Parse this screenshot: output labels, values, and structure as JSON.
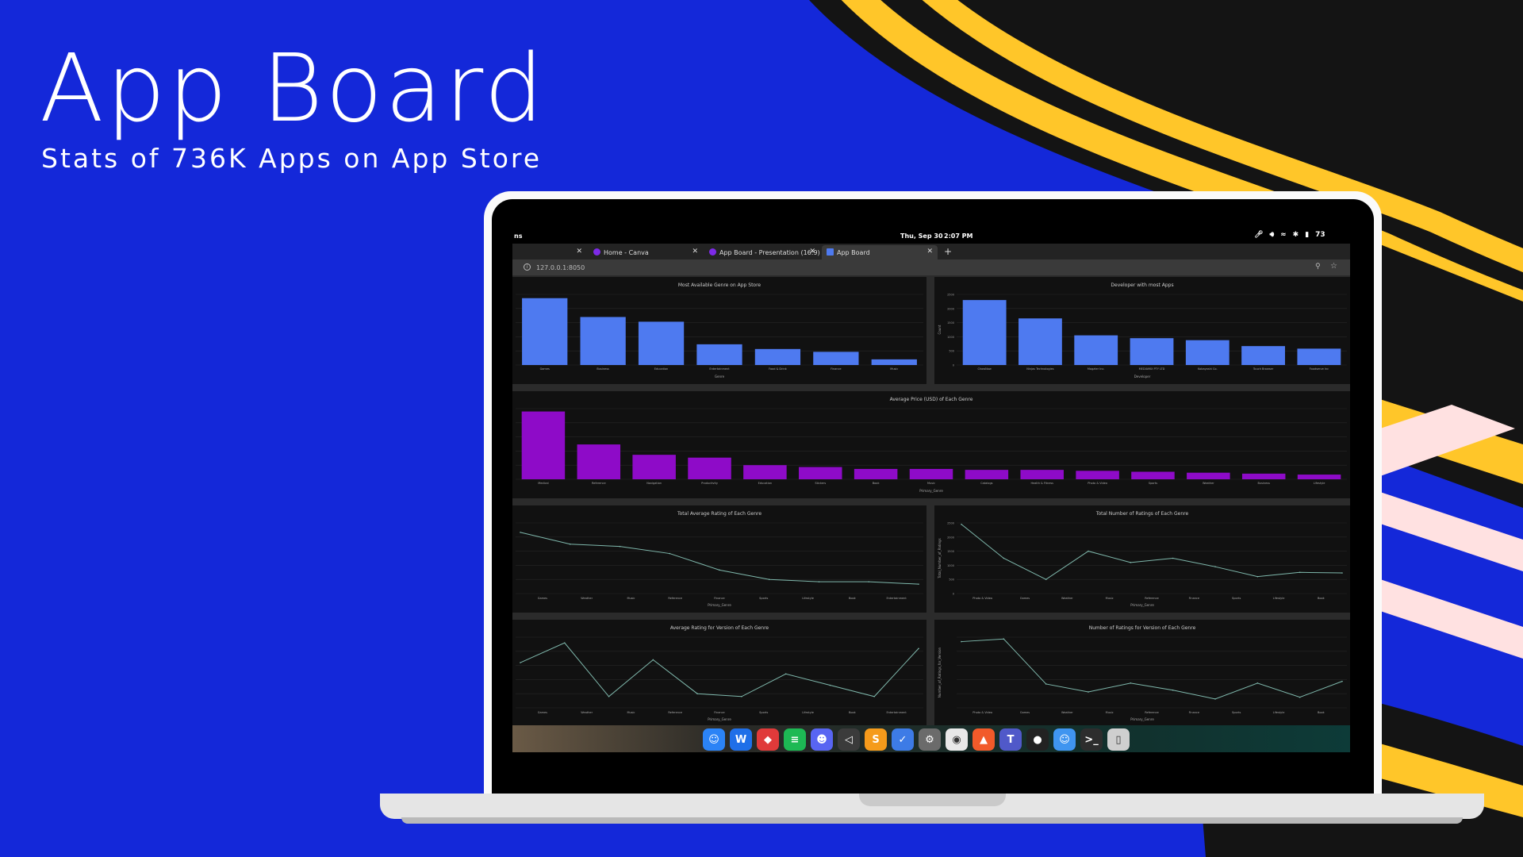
{
  "hero": {
    "title": "App Board",
    "subtitle": "Stats of 736K Apps on App Store"
  },
  "colors": {
    "background": "#1428d9",
    "accent_yellow": "#ffc629",
    "stripe_black": "#141414",
    "stripe_pink": "#ffe1e1",
    "bar_blue": "#4e7af0",
    "bar_purple": "#8e0bc8",
    "line_teal": "#7fb8ac"
  },
  "screen": {
    "topbar": {
      "left_text": "ns",
      "date": "Thu, Sep 30",
      "time": "2:07 PM",
      "battery": "73"
    },
    "tabs": [
      {
        "label": "",
        "active": false
      },
      {
        "label": "Home - Canva",
        "active": false
      },
      {
        "label": "App Board - Presentation (16:9)",
        "active": false
      },
      {
        "label": "App Board",
        "active": true
      }
    ],
    "new_tab": "+",
    "url": "127.0.0.1:8050",
    "dock_icons": [
      "finder-icon",
      "wps-icon",
      "anydesk-icon",
      "spotify-icon",
      "discord-icon",
      "vscode-icon",
      "sublime-icon",
      "ticktick-icon",
      "settings-icon",
      "chrome-icon",
      "brave-icon",
      "teams-icon",
      "github-icon",
      "finder-folder-icon",
      "terminal-icon",
      "trash-icon"
    ]
  },
  "chart_data": [
    {
      "type": "bar",
      "title": "Most Available Genre on App Store",
      "xlabel": "Genre",
      "ylabel": "",
      "categories": [
        "Games",
        "Business",
        "Education",
        "Entertainment",
        "Food & Drink",
        "Finance",
        "Music"
      ],
      "values": [
        71,
        51,
        46,
        22,
        17,
        14,
        6
      ],
      "ylim": [
        0,
        75
      ],
      "color": "#4e7af0"
    },
    {
      "type": "bar",
      "title": "Developer with most Apps",
      "xlabel": "Developer",
      "ylabel": "Count",
      "categories": [
        "ChowNow",
        "Ninjas Technologies",
        "Magzter Inc.",
        "MEDIAMIX PTY LTD",
        "Kobayashi Co.",
        "Touch Browser",
        "Foodserve Inc"
      ],
      "values": [
        2300,
        1650,
        1050,
        950,
        880,
        670,
        580
      ],
      "ylim": [
        0,
        2500
      ],
      "yticks": [
        "0",
        "500",
        "1000",
        "1500",
        "2000",
        "2500"
      ],
      "color": "#4e7af0"
    },
    {
      "type": "bar",
      "title": "Average Price (USD) of Each Genre",
      "xlabel": "Primary_Genre",
      "ylabel": "",
      "categories": [
        "Medical",
        "Reference",
        "Navigation",
        "Productivity",
        "Education",
        "Stickers",
        "Book",
        "Music",
        "Catalogs",
        "Health & Fitness",
        "Photo & Video",
        "Sports",
        "Weather",
        "Business",
        "Lifestyle"
      ],
      "values": [
        72,
        37,
        26,
        23,
        15,
        13,
        11,
        11,
        10,
        10,
        9,
        8,
        7,
        6,
        5
      ],
      "ylim": [
        0,
        75
      ],
      "color": "#8e0bc8"
    },
    {
      "type": "line",
      "title": "Total Average Rating of Each Genre",
      "xlabel": "Primary_Genre",
      "ylabel": "",
      "categories": [
        "Games",
        "Weather",
        "Music",
        "Reference",
        "Finance",
        "Sports",
        "Lifestyle",
        "Book",
        "Entertainment"
      ],
      "values": [
        4.0,
        3.75,
        3.7,
        3.55,
        3.2,
        3.0,
        2.95,
        2.95,
        2.9
      ],
      "ylim": [
        2.7,
        4.2
      ],
      "color": "#7fb8ac"
    },
    {
      "type": "line",
      "title": "Total Number of Ratings of Each Genre",
      "xlabel": "Primary_Genre",
      "ylabel": "Total_Number_of_Ratings",
      "categories": [
        "Photo & Video",
        "Games",
        "Weather",
        "Music",
        "Reference",
        "Finance",
        "Sports",
        "Lifestyle",
        "Book"
      ],
      "values": [
        2450,
        1250,
        500,
        1500,
        1100,
        1250,
        950,
        600,
        750,
        730
      ],
      "ylim": [
        0,
        2500
      ],
      "yticks": [
        "0",
        "500",
        "1000",
        "1500",
        "2000",
        "2500"
      ],
      "color": "#7fb8ac"
    },
    {
      "type": "line",
      "title": "Average Rating for Version of Each Genre",
      "xlabel": "Primary_Genre",
      "ylabel": "",
      "categories": [
        "Games",
        "Weather",
        "Music",
        "Reference",
        "Finance",
        "Sports",
        "Lifestyle",
        "Book",
        "Entertainment"
      ],
      "values": [
        3.6,
        4.3,
        2.4,
        3.7,
        2.5,
        2.4,
        3.2,
        2.8,
        2.4,
        4.1
      ],
      "ylim": [
        2,
        4.5
      ],
      "color": "#7fb8ac"
    },
    {
      "type": "line",
      "title": "Number of Ratings for Version of Each Genre",
      "xlabel": "Primary_Genre",
      "ylabel": "Number_of_Ratings_for_Version",
      "categories": [
        "Photo & Video",
        "Games",
        "Weather",
        "Music",
        "Reference",
        "Finance",
        "Sports",
        "Lifestyle",
        "Book"
      ],
      "values": [
        75,
        78,
        27,
        18,
        28,
        20,
        10,
        28,
        12,
        30
      ],
      "ylim": [
        0,
        80
      ],
      "color": "#7fb8ac"
    }
  ]
}
